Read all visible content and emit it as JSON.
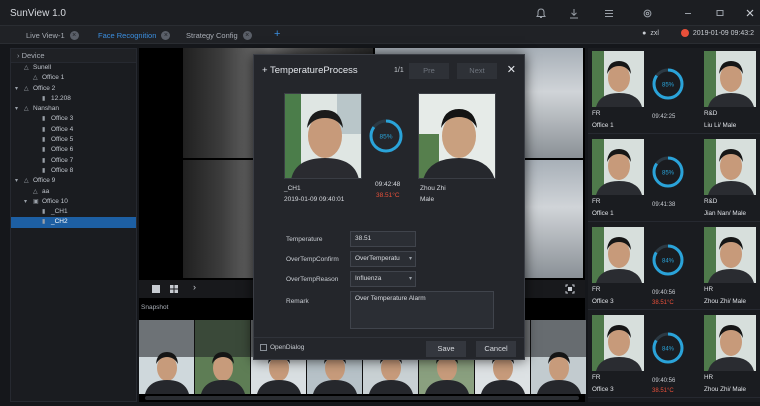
{
  "app": {
    "title": "SunView 1.0"
  },
  "titlebar": {
    "icons": [
      "bell-icon",
      "download-icon",
      "menu-icon",
      "settings-icon",
      "minimize-icon",
      "maximize-icon",
      "close-icon"
    ]
  },
  "tabs": [
    {
      "label": "Live View-1",
      "active": false
    },
    {
      "label": "Face Recognition",
      "active": true
    },
    {
      "label": "Strategy Config",
      "active": false
    }
  ],
  "user": {
    "name": "zxl",
    "datetime": "2019-01-09 09:43:2"
  },
  "sidebar": {
    "header": "Device",
    "tree": [
      {
        "label": "Sunell",
        "icon": "site-icon",
        "indent": 0,
        "expander": ""
      },
      {
        "label": "Office 1",
        "icon": "site-icon",
        "indent": 1,
        "expander": ""
      },
      {
        "label": "Office 2",
        "icon": "site-icon",
        "indent": 0,
        "expander": "▾"
      },
      {
        "label": "12.208",
        "icon": "camera-icon",
        "indent": 2,
        "expander": ""
      },
      {
        "label": "Nanshan",
        "icon": "site-icon",
        "indent": 0,
        "expander": "▾"
      },
      {
        "label": "Office 3",
        "icon": "camera-icon",
        "indent": 2,
        "expander": ""
      },
      {
        "label": "Office 4",
        "icon": "camera-icon",
        "indent": 2,
        "expander": ""
      },
      {
        "label": "Office 5",
        "icon": "camera-icon",
        "indent": 2,
        "expander": ""
      },
      {
        "label": "Office 6",
        "icon": "camera-icon",
        "indent": 2,
        "expander": ""
      },
      {
        "label": "Office 7",
        "icon": "camera-icon",
        "indent": 2,
        "expander": ""
      },
      {
        "label": "Office 8",
        "icon": "camera-icon",
        "indent": 2,
        "expander": ""
      },
      {
        "label": "Office 9",
        "icon": "site-icon",
        "indent": 0,
        "expander": "▾"
      },
      {
        "label": "aa",
        "icon": "site-icon",
        "indent": 1,
        "expander": ""
      },
      {
        "label": "Office 10",
        "icon": "nvr-icon",
        "indent": 1,
        "expander": "▾"
      },
      {
        "label": "_CH1",
        "icon": "camera-icon",
        "indent": 2,
        "expander": ""
      },
      {
        "label": "_CH2",
        "icon": "camera-icon",
        "indent": 2,
        "expander": "",
        "selected": true
      }
    ]
  },
  "snapshot": {
    "label": "Snapshot"
  },
  "recognition_list": [
    {
      "similarity": "85%",
      "group": "FR",
      "location": "Office 1",
      "time": "09:42:25",
      "temp": "",
      "person": "Liu Li/ Male",
      "group2": "R&D",
      "ring_color": "#2aa3d9",
      "level": 0.85
    },
    {
      "similarity": "85%",
      "group": "FR",
      "location": "Office 1",
      "time": "09:41:38",
      "temp": "",
      "person": "Jian Nan/ Male",
      "group2": "R&D",
      "ring_color": "#2aa3d9",
      "level": 0.85
    },
    {
      "similarity": "84%",
      "group": "FR",
      "location": "Office 3",
      "time": "09:40:56",
      "temp": "38.51°C",
      "person": "Zhou Zhi/ Male",
      "group2": "HR",
      "ring_color": "#2aa3d9",
      "level": 0.84
    },
    {
      "similarity": "84%",
      "group": "FR",
      "location": "Office 3",
      "time": "09:40:56",
      "temp": "38.51°C",
      "person": "Zhou Zhi/ Male",
      "group2": "HR",
      "ring_color": "#2aa3d9",
      "level": 0.84
    }
  ],
  "modal": {
    "title": "TemperatureProcess",
    "page": "1/1",
    "prev": "Pre",
    "next": "Next",
    "left": {
      "channel": "_CH1",
      "datetime": "2019-01-09 09:40:01"
    },
    "similarity": "85%",
    "similarity_level": 0.85,
    "time": "09:42:48",
    "temp": "38.51°C",
    "right": {
      "name": "Zhou Zhi",
      "gender": "Male"
    },
    "fields": {
      "temperature_label": "Temperature",
      "temperature_value": "38.51",
      "confirm_label": "OverTempConfirm",
      "confirm_value": "OverTemperatu",
      "reason_label": "OverTempReason",
      "reason_value": "Influenza",
      "remark_label": "Remark",
      "remark_value": "Over Temperature Alarm"
    },
    "open_dialog": "OpenDialog",
    "save": "Save",
    "cancel": "Cancel"
  }
}
